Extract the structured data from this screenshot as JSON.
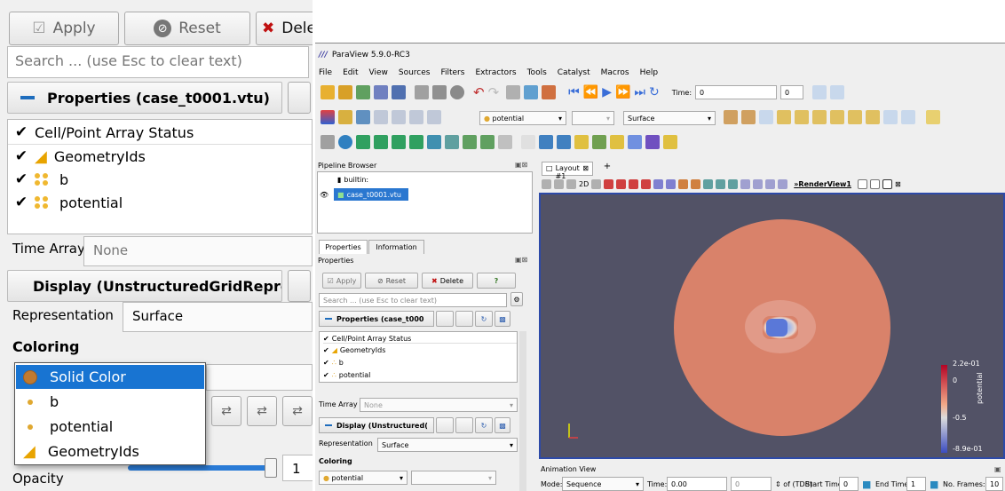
{
  "zoom": {
    "apply": "Apply",
    "reset": "Reset",
    "delete": "Delet",
    "search_placeholder": "Search ... (use Esc to clear text)",
    "properties_title": "Properties (case_t0001.vtu)",
    "array_status_header": "Cell/Point Array Status",
    "arrays": [
      "GeometryIds",
      "b",
      "potential"
    ],
    "time_array_label": "Time Array",
    "time_array_value": "None",
    "display_title": "Display (UnstructuredGridRepres",
    "representation_label": "Representation",
    "representation_value": "Surface",
    "coloring_label": "Coloring",
    "dropdown_options": [
      "Solid Color",
      "b",
      "potential",
      "GeometryIds"
    ],
    "opacity_label": "Opacity",
    "opacity_value": "1"
  },
  "pv": {
    "title": "ParaView 5.9.0-RC3",
    "menu": [
      "File",
      "Edit",
      "View",
      "Sources",
      "Filters",
      "Extractors",
      "Tools",
      "Catalyst",
      "Macros",
      "Help"
    ],
    "time_label": "Time:",
    "time_value": "0",
    "time_index": "0",
    "color_array": "potential",
    "representation": "Surface",
    "pipeline_title": "Pipeline Browser",
    "builtin": "builtin:",
    "pipeline_item": "case_t0001.vtu",
    "layout_tab": "Layout #1",
    "add_tab": "+",
    "view_2d": "2D",
    "render_view": "RenderView1",
    "tab_properties": "Properties",
    "tab_information": "Information",
    "properties_label": "Properties",
    "apply": "Apply",
    "reset": "Reset",
    "delete": "Delete",
    "help": "?",
    "search_placeholder": "Search ... (use Esc to clear text)",
    "properties_title": "Properties (case_t000",
    "array_status_header": "Cell/Point Array Status",
    "arrays": [
      "GeometryIds",
      "b",
      "potential"
    ],
    "time_array_label": "Time Array",
    "time_array_value": "None",
    "display_title": "Display (Unstructured(",
    "representation_label": "Representation",
    "representation_value": "Surface",
    "coloring_label": "Coloring",
    "coloring_value": "potential",
    "legend_title": "potential",
    "legend_ticks": [
      "2.2e-01",
      "0",
      "-0.5",
      "-8.9e-01"
    ],
    "animation_title": "Animation View",
    "mode_label": "Mode:",
    "mode_value": "Sequence",
    "anim_time_label": "Time:",
    "anim_time_value": "0.00",
    "anim_index": "0",
    "of_tdb": "of (TDB)",
    "start_time_label": "Start Time:",
    "start_time_value": "0",
    "end_time_label": "End Time:",
    "end_time_value": "1",
    "frames_label": "No. Frames:",
    "frames_value": "10"
  },
  "colors": {
    "accent": "#1874d2",
    "surface": "#d9826a",
    "selection": "#2a77d0"
  }
}
